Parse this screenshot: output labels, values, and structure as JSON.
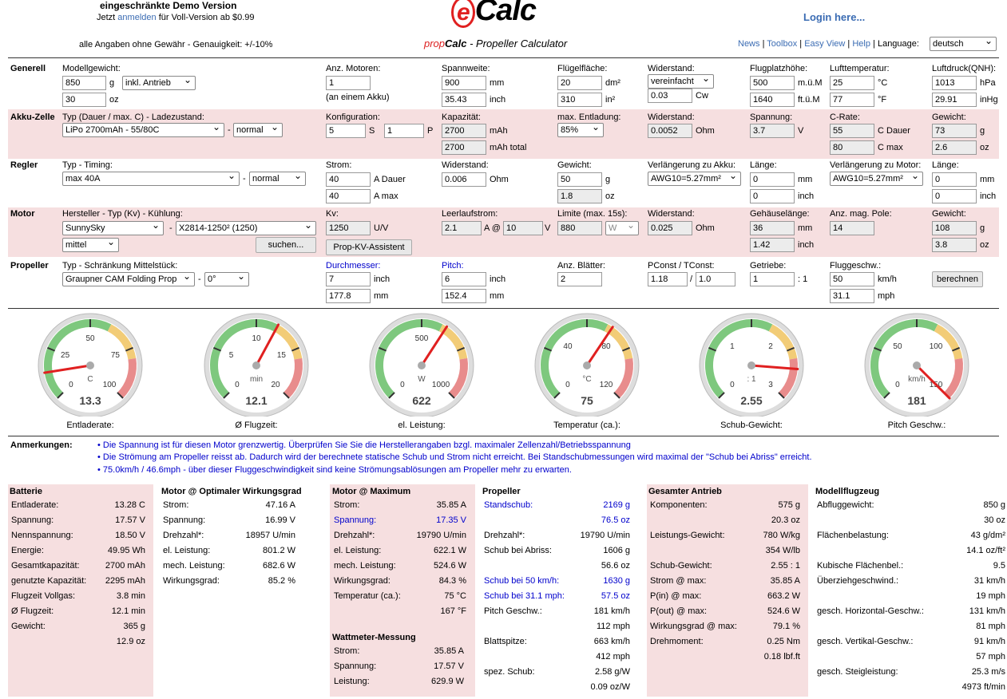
{
  "header": {
    "demo_title": "eingeschränkte Demo Version",
    "demo_line_prefix": "Jetzt",
    "demo_link": "anmelden",
    "demo_line_suffix": "für Voll-Version ab $0.99",
    "disclaimer": "alle Angaben ohne Gewähr - Genauigkeit: +/-10%",
    "logo_e": "e",
    "logo_rest": "Calc",
    "subtitle_prop": "prop",
    "subtitle_calc": "Calc",
    "subtitle_rest": " - Propeller Calculator",
    "login": "Login here...",
    "nav": [
      "News",
      "Toolbox",
      "Easy View",
      "Help"
    ],
    "language_label": "Language:",
    "language_value": "deutsch"
  },
  "sections": {
    "generell": "Generell",
    "akku": "Akku-Zelle",
    "regler": "Regler",
    "motor": "Motor",
    "propeller": "Propeller"
  },
  "generell": {
    "modell_label": "Modellgewicht:",
    "modell_g": "850",
    "unit_g": "g",
    "antrieb": "inkl. Antrieb",
    "modell_oz": "30",
    "unit_oz": "oz",
    "motoren_label": "Anz. Motoren:",
    "motoren": "1",
    "motoren_note": "(an einem Akku)",
    "spann_label": "Spannweite:",
    "spann_mm": "900",
    "unit_mm": "mm",
    "spann_inch": "35.43",
    "unit_inch": "inch",
    "flaeche_label": "Flügelfläche:",
    "flaeche_dm": "20",
    "unit_dm": "dm²",
    "flaeche_in": "310",
    "unit_in": "in²",
    "wid_label": "Widerstand:",
    "wid_sel": "vereinfacht",
    "wid_cw": "0.03",
    "unit_cw": "Cw",
    "platz_label": "Flugplatzhöhe:",
    "platz_m": "500",
    "unit_m": "m.ü.M",
    "platz_ft": "1640",
    "unit_ft": "ft.ü.M",
    "temp_label": "Lufttemperatur:",
    "temp_c": "25",
    "unit_c": "°C",
    "temp_f": "77",
    "unit_f": "°F",
    "druck_label": "Luftdruck(QNH):",
    "druck_hpa": "1013",
    "unit_hpa": "hPa",
    "druck_inhg": "29.91",
    "unit_inhg": "inHg"
  },
  "akku": {
    "typ_label": "Typ (Dauer / max. C) - Ladezustand:",
    "typ": "LiPo 2700mAh - 55/80C",
    "dash": "-",
    "zustand": "normal",
    "konf_label": "Konfiguration:",
    "s": "5",
    "unit_s": "S",
    "p": "1",
    "unit_p": "P",
    "kap_label": "Kapazität:",
    "kap": "2700",
    "unit_mah": "mAh",
    "kap_total": "2700",
    "unit_mah_total": "mAh total",
    "ent_label": "max. Entladung:",
    "ent": "85%",
    "wid_label": "Widerstand:",
    "wid": "0.0052",
    "unit_ohm": "Ohm",
    "spann_label": "Spannung:",
    "spann": "3.7",
    "unit_v": "V",
    "crate_label": "C-Rate:",
    "c_dauer": "55",
    "unit_cd": "C Dauer",
    "c_max": "80",
    "unit_cm": "C max",
    "gew_label": "Gewicht:",
    "gew_g": "73",
    "unit_g": "g",
    "gew_oz": "2.6",
    "unit_oz": "oz"
  },
  "regler": {
    "typ_label": "Typ - Timing:",
    "typ": "max 40A",
    "dash": "-",
    "timing": "normal",
    "strom_label": "Strom:",
    "a_dauer": "40",
    "unit_ad": "A Dauer",
    "a_max": "40",
    "unit_am": "A max",
    "wid_label": "Widerstand:",
    "wid": "0.006",
    "unit_ohm": "Ohm",
    "gew_label": "Gewicht:",
    "gew_g": "50",
    "unit_g": "g",
    "gew_oz": "1.8",
    "unit_oz": "oz",
    "vakku_label": "Verlängerung zu Akku:",
    "vakku": "AWG10=5.27mm²",
    "len1_label": "Länge:",
    "len1_mm": "0",
    "unit_mm": "mm",
    "len1_inch": "0",
    "unit_inch": "inch",
    "vmotor_label": "Verlängerung zu Motor:",
    "vmotor": "AWG10=5.27mm²",
    "len2_label": "Länge:",
    "len2_mm": "0",
    "len2_inch": "0"
  },
  "motor": {
    "typ_label": "Hersteller - Typ (Kv) - Kühlung:",
    "hersteller": "SunnySky",
    "dash": "-",
    "typ": "X2814-1250² (1250)",
    "kuehlung": "mittel",
    "suchen": "suchen...",
    "kv_label": "Kv:",
    "kv": "1250",
    "unit_uv": "U/V",
    "kv_btn": "Prop-KV-Assistent",
    "leer_label": "Leerlaufstrom:",
    "leer_a": "2.1",
    "unit_aat": "A @",
    "leer_v": "10",
    "unit_v": "V",
    "lim_label": "Limite (max. 15s):",
    "lim": "880",
    "lim_unit": "W",
    "wid_label": "Widerstand:",
    "wid": "0.025",
    "unit_ohm": "Ohm",
    "gehlen_label": "Gehäuselänge:",
    "gehlen_mm": "36",
    "unit_mm": "mm",
    "gehlen_inch": "1.42",
    "unit_inch": "inch",
    "pole_label": "Anz. mag. Pole:",
    "pole": "14",
    "gew_label": "Gewicht:",
    "gew_g": "108",
    "unit_g": "g",
    "gew_oz": "3.8",
    "unit_oz": "oz"
  },
  "propeller": {
    "typ_label": "Typ - Schränkung Mittelstück:",
    "typ": "Graupner CAM Folding Prop",
    "dash": "-",
    "schraenk": "0°",
    "dm_label": "Durchmesser:",
    "dm_inch": "7",
    "unit_inch": "inch",
    "dm_mm": "177.8",
    "unit_mm": "mm",
    "pitch_label": "Pitch:",
    "pitch_inch": "6",
    "pitch_mm": "152.4",
    "blatt_label": "Anz. Blätter:",
    "blatt": "2",
    "pconst_label": "PConst / TConst:",
    "pconst": "1.18",
    "slash": "/",
    "tconst": "1.0",
    "getr_label": "Getriebe:",
    "getr": "1",
    "getr_ratio": ": 1",
    "flug_label": "Fluggeschw.:",
    "flug_kmh": "50",
    "unit_kmh": "km/h",
    "flug_mph": "31.1",
    "unit_mph": "mph",
    "berechnen": "berechnen"
  },
  "gauges": [
    {
      "label": "Entladerate:",
      "value": "13.3",
      "unit": "C",
      "ticks": [
        "0",
        "25",
        "50",
        "75",
        "100"
      ],
      "fraction": 0.133
    },
    {
      "label": "Ø Flugzeit:",
      "value": "12.1",
      "unit": "min",
      "ticks": [
        "0",
        "5",
        "10",
        "15",
        "20"
      ],
      "fraction": 0.605
    },
    {
      "label": "el. Leistung:",
      "value": "622",
      "unit": "W",
      "ticks": [
        "0",
        "500",
        "1000"
      ],
      "fraction": 0.622
    },
    {
      "label": "Temperatur (ca.):",
      "value": "75",
      "unit": "°C",
      "ticks": [
        "0",
        "40",
        "80",
        "120"
      ],
      "fraction": 0.625
    },
    {
      "label": "Schub-Gewicht:",
      "value": "2.55",
      "unit": ": 1",
      "ticks": [
        "0",
        "1",
        "2",
        "3"
      ],
      "fraction": 0.85
    },
    {
      "label": "Pitch Geschw.:",
      "value": "181",
      "unit": "km/h",
      "ticks": [
        "0",
        "50",
        "100",
        "150"
      ],
      "fraction": 1.0
    }
  ],
  "notes": {
    "label": "Anmerkungen:",
    "items": [
      "Die Spannung ist für diesen Motor grenzwertig. Überprüfen Sie Sie die Herstellerangaben bzgl. maximaler Zellenzahl/Betriebsspannung",
      "Die Strömung am Propeller reisst ab. Dadurch wird der berechnete statische Schub und Strom nicht erreicht. Bei Standschubmessungen wird maximal der \"Schub bei Abriss\" erreicht.",
      "75.0km/h / 46.6mph - über dieser Fluggeschwindigkeit sind keine Strömungsablösungen am Propeller mehr zu erwarten."
    ]
  },
  "results": {
    "batterie": {
      "title": "Batterie",
      "rows": [
        [
          "Entladerate:",
          "13.28 C"
        ],
        [
          "Spannung:",
          "17.57 V"
        ],
        [
          "Nennspannung:",
          "18.50 V"
        ],
        [
          "Energie:",
          "49.95 Wh"
        ],
        [
          "Gesamtkapazität:",
          "2700 mAh"
        ],
        [
          "genutzte Kapazität:",
          "2295 mAh"
        ],
        [
          "Flugzeit Vollgas:",
          "3.8 min"
        ],
        [
          "Ø Flugzeit:",
          "12.1 min"
        ],
        [
          "Gewicht:",
          "365 g"
        ],
        [
          "",
          "12.9 oz"
        ]
      ]
    },
    "motor_opt": {
      "title": "Motor @ Optimaler Wirkungsgrad",
      "rows": [
        [
          "Strom:",
          "47.16 A"
        ],
        [
          "Spannung:",
          "16.99 V"
        ],
        [
          "Drehzahl*:",
          "18957 U/min"
        ],
        [
          "el. Leistung:",
          "801.2 W"
        ],
        [
          "mech. Leistung:",
          "682.6 W"
        ],
        [
          "Wirkungsgrad:",
          "85.2 %"
        ]
      ]
    },
    "motor_max": {
      "title": "Motor @ Maximum",
      "rows": [
        [
          "Strom:",
          "35.85 A"
        ],
        [
          "Spannung:",
          "17.35 V"
        ],
        [
          "Drehzahl*:",
          "19790 U/min"
        ],
        [
          "el. Leistung:",
          "622.1 W"
        ],
        [
          "mech. Leistung:",
          "524.6 W"
        ],
        [
          "Wirkungsgrad:",
          "84.3 %"
        ],
        [
          "Temperatur (ca.):",
          "75 °C"
        ],
        [
          "",
          "167 °F"
        ]
      ]
    },
    "wattmeter": {
      "title": "Wattmeter-Messung",
      "rows": [
        [
          "Strom:",
          "35.85 A"
        ],
        [
          "Spannung:",
          "17.57 V"
        ],
        [
          "Leistung:",
          "629.9 W"
        ]
      ]
    },
    "propeller": {
      "title": "Propeller",
      "rows": [
        [
          "Standschub:",
          "2169 g"
        ],
        [
          "",
          "76.5 oz"
        ],
        [
          "Drehzahl*:",
          "19790 U/min"
        ],
        [
          "Schub bei Abriss:",
          "1606 g"
        ],
        [
          "",
          "56.6 oz"
        ],
        [
          "Schub bei 50 km/h:",
          "1630 g"
        ],
        [
          "Schub bei 31.1 mph:",
          "57.5 oz"
        ],
        [
          "Pitch Geschw.:",
          "181 km/h"
        ],
        [
          "",
          "112 mph"
        ],
        [
          "Blattspitze:",
          "663 km/h"
        ],
        [
          "",
          "412 mph"
        ],
        [
          "spez. Schub:",
          "2.58 g/W"
        ],
        [
          "",
          "0.09 oz/W"
        ]
      ]
    },
    "antrieb": {
      "title": "Gesamter Antrieb",
      "rows": [
        [
          "Komponenten:",
          "575 g"
        ],
        [
          "",
          "20.3 oz"
        ],
        [
          "Leistungs-Gewicht:",
          "780 W/kg"
        ],
        [
          "",
          "354 W/lb"
        ],
        [
          "Schub-Gewicht:",
          "2.55 : 1"
        ],
        [
          "Strom @ max:",
          "35.85 A"
        ],
        [
          "P(in) @ max:",
          "663.2 W"
        ],
        [
          "P(out) @ max:",
          "524.6 W"
        ],
        [
          "Wirkungsgrad @ max:",
          "79.1 %"
        ],
        [
          "Drehmoment:",
          "0.25 Nm"
        ],
        [
          "",
          "0.18 lbf.ft"
        ]
      ]
    },
    "modell": {
      "title": "Modellflugzeug",
      "rows": [
        [
          "Abfluggewicht:",
          "850 g"
        ],
        [
          "",
          "30 oz"
        ],
        [
          "Flächenbelastung:",
          "43 g/dm²"
        ],
        [
          "",
          "14.1 oz/ft²"
        ],
        [
          "Kubische Flächenbel.:",
          "9.5"
        ],
        [
          "Überziehgeschwind.:",
          "31 km/h"
        ],
        [
          "",
          "19 mph"
        ],
        [
          "gesch. Horizontal-Geschw.:",
          "131 km/h"
        ],
        [
          "",
          "81 mph"
        ],
        [
          "gesch. Vertikal-Geschw.:",
          "91 km/h"
        ],
        [
          "",
          "57 mph"
        ],
        [
          "gesch. Steigleistung:",
          "25.3 m/s"
        ],
        [
          "",
          "4973 ft/min"
        ]
      ]
    }
  }
}
